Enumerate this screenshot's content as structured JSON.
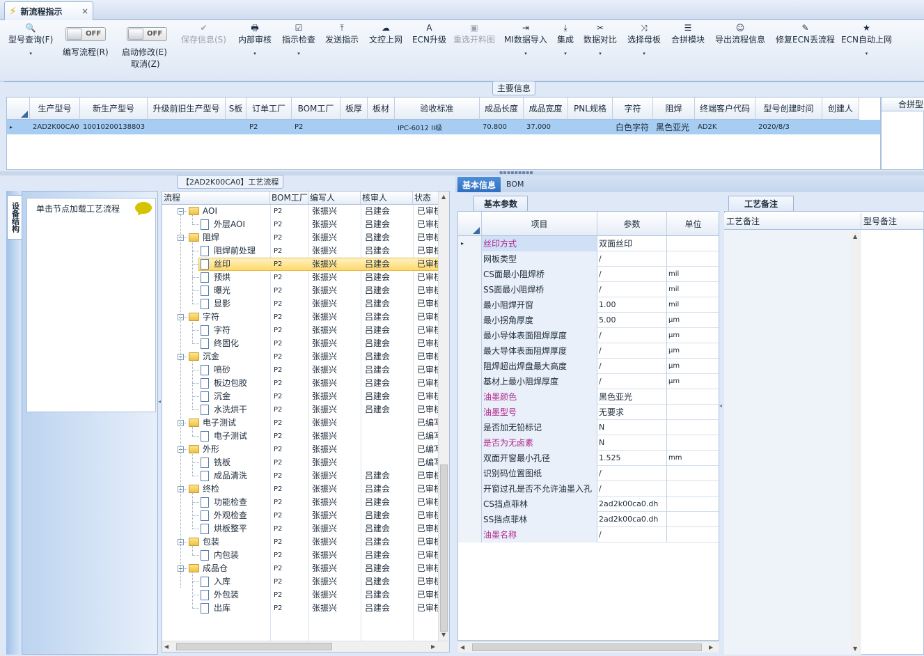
{
  "tab": {
    "title": "新流程指示",
    "close": "×"
  },
  "toolbar": {
    "buttons": [
      {
        "label": "型号查询(F)",
        "icon": "🔍",
        "dropdown": "▾"
      },
      {
        "label": "保存信息(S)",
        "icon": "✔"
      },
      {
        "label": "内部审核",
        "icon": "🖶",
        "dropdown": "▾"
      },
      {
        "label": "指示检查",
        "icon": "☑",
        "dropdown": "▾"
      },
      {
        "label": "发送指示",
        "icon": "⤒"
      },
      {
        "label": "文控上网",
        "icon": "☁"
      },
      {
        "label": "ECN升级",
        "icon": "A"
      },
      {
        "label": "重选开料图",
        "icon": "▣"
      },
      {
        "label": "MI数据导入",
        "icon": "⇥",
        "dropdown": "▾"
      },
      {
        "label": "集成",
        "icon": "⤓",
        "dropdown": "▾"
      },
      {
        "label": "数据对比",
        "icon": "✂",
        "dropdown": "▾"
      },
      {
        "label": "选择母板",
        "icon": "⤨",
        "dropdown": "▾"
      },
      {
        "label": "合拼模块",
        "icon": "☰"
      },
      {
        "label": "导出流程信息",
        "icon": "☺"
      },
      {
        "label": "修复ECN丢流程",
        "icon": "✎"
      },
      {
        "label": "ECN自动上网",
        "icon": "★",
        "dropdown": "▾"
      }
    ],
    "toggle_edit": {
      "state": "OFF",
      "label": "编写流程(R)"
    },
    "toggle_modify": {
      "state": "OFF",
      "label": "启动修改(E)",
      "label2": "取消(Z)"
    }
  },
  "main_info": {
    "title": "主要信息",
    "columns": [
      "生产型号",
      "新生产型号",
      "升级前旧生产型号",
      "S板",
      "订单工厂",
      "BOM工厂",
      "板厚",
      "板材",
      "验收标准",
      "成品长度",
      "成品宽度",
      "PNL规格",
      "字符",
      "阻焊",
      "终端客户代码",
      "型号创建时间",
      "创建人"
    ],
    "row": [
      "2AD2K00CA0",
      "10010200138803",
      "",
      "",
      "P2",
      "P2",
      "",
      "",
      "IPC-6012 II级",
      "70.800",
      "37.000",
      "",
      "白色字符",
      "黑色亚光",
      "AD2K",
      "2020/8/3",
      ""
    ],
    "row_marker": "▸",
    "hebin_header": "合拼型"
  },
  "left_panel": {
    "vertical_tab": "设备结构",
    "hint": "单击节点加载工艺流程"
  },
  "tree": {
    "title": "【2AD2K00CA0】工艺流程",
    "columns": [
      "流程",
      "BOM工厂",
      "编写人",
      "核审人",
      "状态"
    ],
    "rows": [
      {
        "name": "AOI",
        "folder": true,
        "bom": "P2",
        "writer": "张振兴",
        "reviewer": "吕建会",
        "status": "已审核"
      },
      {
        "name": "外层AOI",
        "folder": false,
        "bom": "P2",
        "writer": "张振兴",
        "reviewer": "吕建会",
        "status": "已审核"
      },
      {
        "name": "阻焊",
        "folder": true,
        "bom": "P2",
        "writer": "张振兴",
        "reviewer": "吕建会",
        "status": "已审核"
      },
      {
        "name": "阻焊前处理",
        "folder": false,
        "bom": "P2",
        "writer": "张振兴",
        "reviewer": "吕建会",
        "status": "已审核"
      },
      {
        "name": "丝印",
        "folder": false,
        "bom": "P2",
        "writer": "张振兴",
        "reviewer": "吕建会",
        "status": "已审核",
        "selected": true
      },
      {
        "name": "预烘",
        "folder": false,
        "bom": "P2",
        "writer": "张振兴",
        "reviewer": "吕建会",
        "status": "已审核"
      },
      {
        "name": "曝光",
        "folder": false,
        "bom": "P2",
        "writer": "张振兴",
        "reviewer": "吕建会",
        "status": "已审核"
      },
      {
        "name": "显影",
        "folder": false,
        "bom": "P2",
        "writer": "张振兴",
        "reviewer": "吕建会",
        "status": "已审核"
      },
      {
        "name": "字符",
        "folder": true,
        "bom": "P2",
        "writer": "张振兴",
        "reviewer": "吕建会",
        "status": "已审核"
      },
      {
        "name": "字符",
        "folder": false,
        "bom": "P2",
        "writer": "张振兴",
        "reviewer": "吕建会",
        "status": "已审核"
      },
      {
        "name": "终固化",
        "folder": false,
        "bom": "P2",
        "writer": "张振兴",
        "reviewer": "吕建会",
        "status": "已审核"
      },
      {
        "name": "沉金",
        "folder": true,
        "bom": "P2",
        "writer": "张振兴",
        "reviewer": "吕建会",
        "status": "已审核"
      },
      {
        "name": "喷砂",
        "folder": false,
        "bom": "P2",
        "writer": "张振兴",
        "reviewer": "吕建会",
        "status": "已审核"
      },
      {
        "name": "板边包胶",
        "folder": false,
        "bom": "P2",
        "writer": "张振兴",
        "reviewer": "吕建会",
        "status": "已审核"
      },
      {
        "name": "沉金",
        "folder": false,
        "bom": "P2",
        "writer": "张振兴",
        "reviewer": "吕建会",
        "status": "已审核"
      },
      {
        "name": "水洗烘干",
        "folder": false,
        "bom": "P2",
        "writer": "张振兴",
        "reviewer": "吕建会",
        "status": "已审核"
      },
      {
        "name": "电子测试",
        "folder": true,
        "bom": "P2",
        "writer": "张振兴",
        "reviewer": "",
        "status": "已编写"
      },
      {
        "name": "电子测试",
        "folder": false,
        "bom": "P2",
        "writer": "张振兴",
        "reviewer": "",
        "status": "已编写"
      },
      {
        "name": "外形",
        "folder": true,
        "bom": "P2",
        "writer": "张振兴",
        "reviewer": "",
        "status": "已编写"
      },
      {
        "name": "铣板",
        "folder": false,
        "bom": "P2",
        "writer": "张振兴",
        "reviewer": "",
        "status": "已编写"
      },
      {
        "name": "成品清洗",
        "folder": false,
        "bom": "P2",
        "writer": "张振兴",
        "reviewer": "吕建会",
        "status": "已审核"
      },
      {
        "name": "终检",
        "folder": true,
        "bom": "P2",
        "writer": "张振兴",
        "reviewer": "吕建会",
        "status": "已审核"
      },
      {
        "name": "功能检查",
        "folder": false,
        "bom": "P2",
        "writer": "张振兴",
        "reviewer": "吕建会",
        "status": "已审核"
      },
      {
        "name": "外观检查",
        "folder": false,
        "bom": "P2",
        "writer": "张振兴",
        "reviewer": "吕建会",
        "status": "已审核"
      },
      {
        "name": "烘板整平",
        "folder": false,
        "bom": "P2",
        "writer": "张振兴",
        "reviewer": "吕建会",
        "status": "已审核"
      },
      {
        "name": "包装",
        "folder": true,
        "bom": "P2",
        "writer": "张振兴",
        "reviewer": "吕建会",
        "status": "已审核"
      },
      {
        "name": "内包装",
        "folder": false,
        "bom": "P2",
        "writer": "张振兴",
        "reviewer": "吕建会",
        "status": "已审核"
      },
      {
        "name": "成品仓",
        "folder": true,
        "bom": "P2",
        "writer": "张振兴",
        "reviewer": "吕建会",
        "status": "已审核"
      },
      {
        "name": "入库",
        "folder": false,
        "bom": "P2",
        "writer": "张振兴",
        "reviewer": "吕建会",
        "status": "已审核"
      },
      {
        "name": "外包装",
        "folder": false,
        "bom": "P2",
        "writer": "张振兴",
        "reviewer": "吕建会",
        "status": "已审核"
      },
      {
        "name": "出库",
        "folder": false,
        "bom": "P2",
        "writer": "张振兴",
        "reviewer": "吕建会",
        "status": "已审核"
      }
    ]
  },
  "right_tabs": {
    "basic": "基本信息",
    "bom": "BOM"
  },
  "params": {
    "subtab": "基本参数",
    "columns": [
      "项目",
      "参数",
      "单位"
    ],
    "rows": [
      {
        "item": "丝印方式",
        "value": "双面丝印",
        "unit": "",
        "hl": true,
        "current": true
      },
      {
        "item": "网板类型",
        "value": "/",
        "unit": ""
      },
      {
        "item": "CS面最小阻焊桥",
        "value": "/",
        "unit": "mil"
      },
      {
        "item": "SS面最小阻焊桥",
        "value": "/",
        "unit": "mil"
      },
      {
        "item": "最小阻焊开窗",
        "value": "1.00",
        "unit": "mil"
      },
      {
        "item": "最小拐角厚度",
        "value": "5.00",
        "unit": "μm"
      },
      {
        "item": "最小导体表面阻焊厚度",
        "value": "/",
        "unit": "μm"
      },
      {
        "item": "最大导体表面阻焊厚度",
        "value": "/",
        "unit": "μm"
      },
      {
        "item": "阻焊超出焊盘最大高度",
        "value": "/",
        "unit": "μm"
      },
      {
        "item": "基材上最小阻焊厚度",
        "value": "/",
        "unit": "μm"
      },
      {
        "item": "油墨颜色",
        "value": "黑色亚光",
        "unit": "",
        "hl": true
      },
      {
        "item": "油墨型号",
        "value": "无要求",
        "unit": "",
        "hl": true
      },
      {
        "item": "是否加无铅标记",
        "value": "N",
        "unit": ""
      },
      {
        "item": "是否为无卤素",
        "value": "N",
        "unit": "",
        "hl": true
      },
      {
        "item": "双面开窗最小孔径",
        "value": "1.525",
        "unit": "mm"
      },
      {
        "item": "识别码位置图纸",
        "value": "/",
        "unit": ""
      },
      {
        "item": "开窗过孔是否不允许油墨入孔",
        "value": "/",
        "unit": ""
      },
      {
        "item": "CS挡点菲林",
        "value": "2ad2k00ca0.dh",
        "unit": ""
      },
      {
        "item": "SS挡点菲林",
        "value": "2ad2k00ca0.dh",
        "unit": ""
      },
      {
        "item": "油墨名称",
        "value": "/",
        "unit": "",
        "hl": true
      }
    ],
    "row_marker": "▸"
  },
  "remarks": {
    "subtab": "工艺备注",
    "columns": [
      "工艺备注",
      "型号备注"
    ]
  }
}
